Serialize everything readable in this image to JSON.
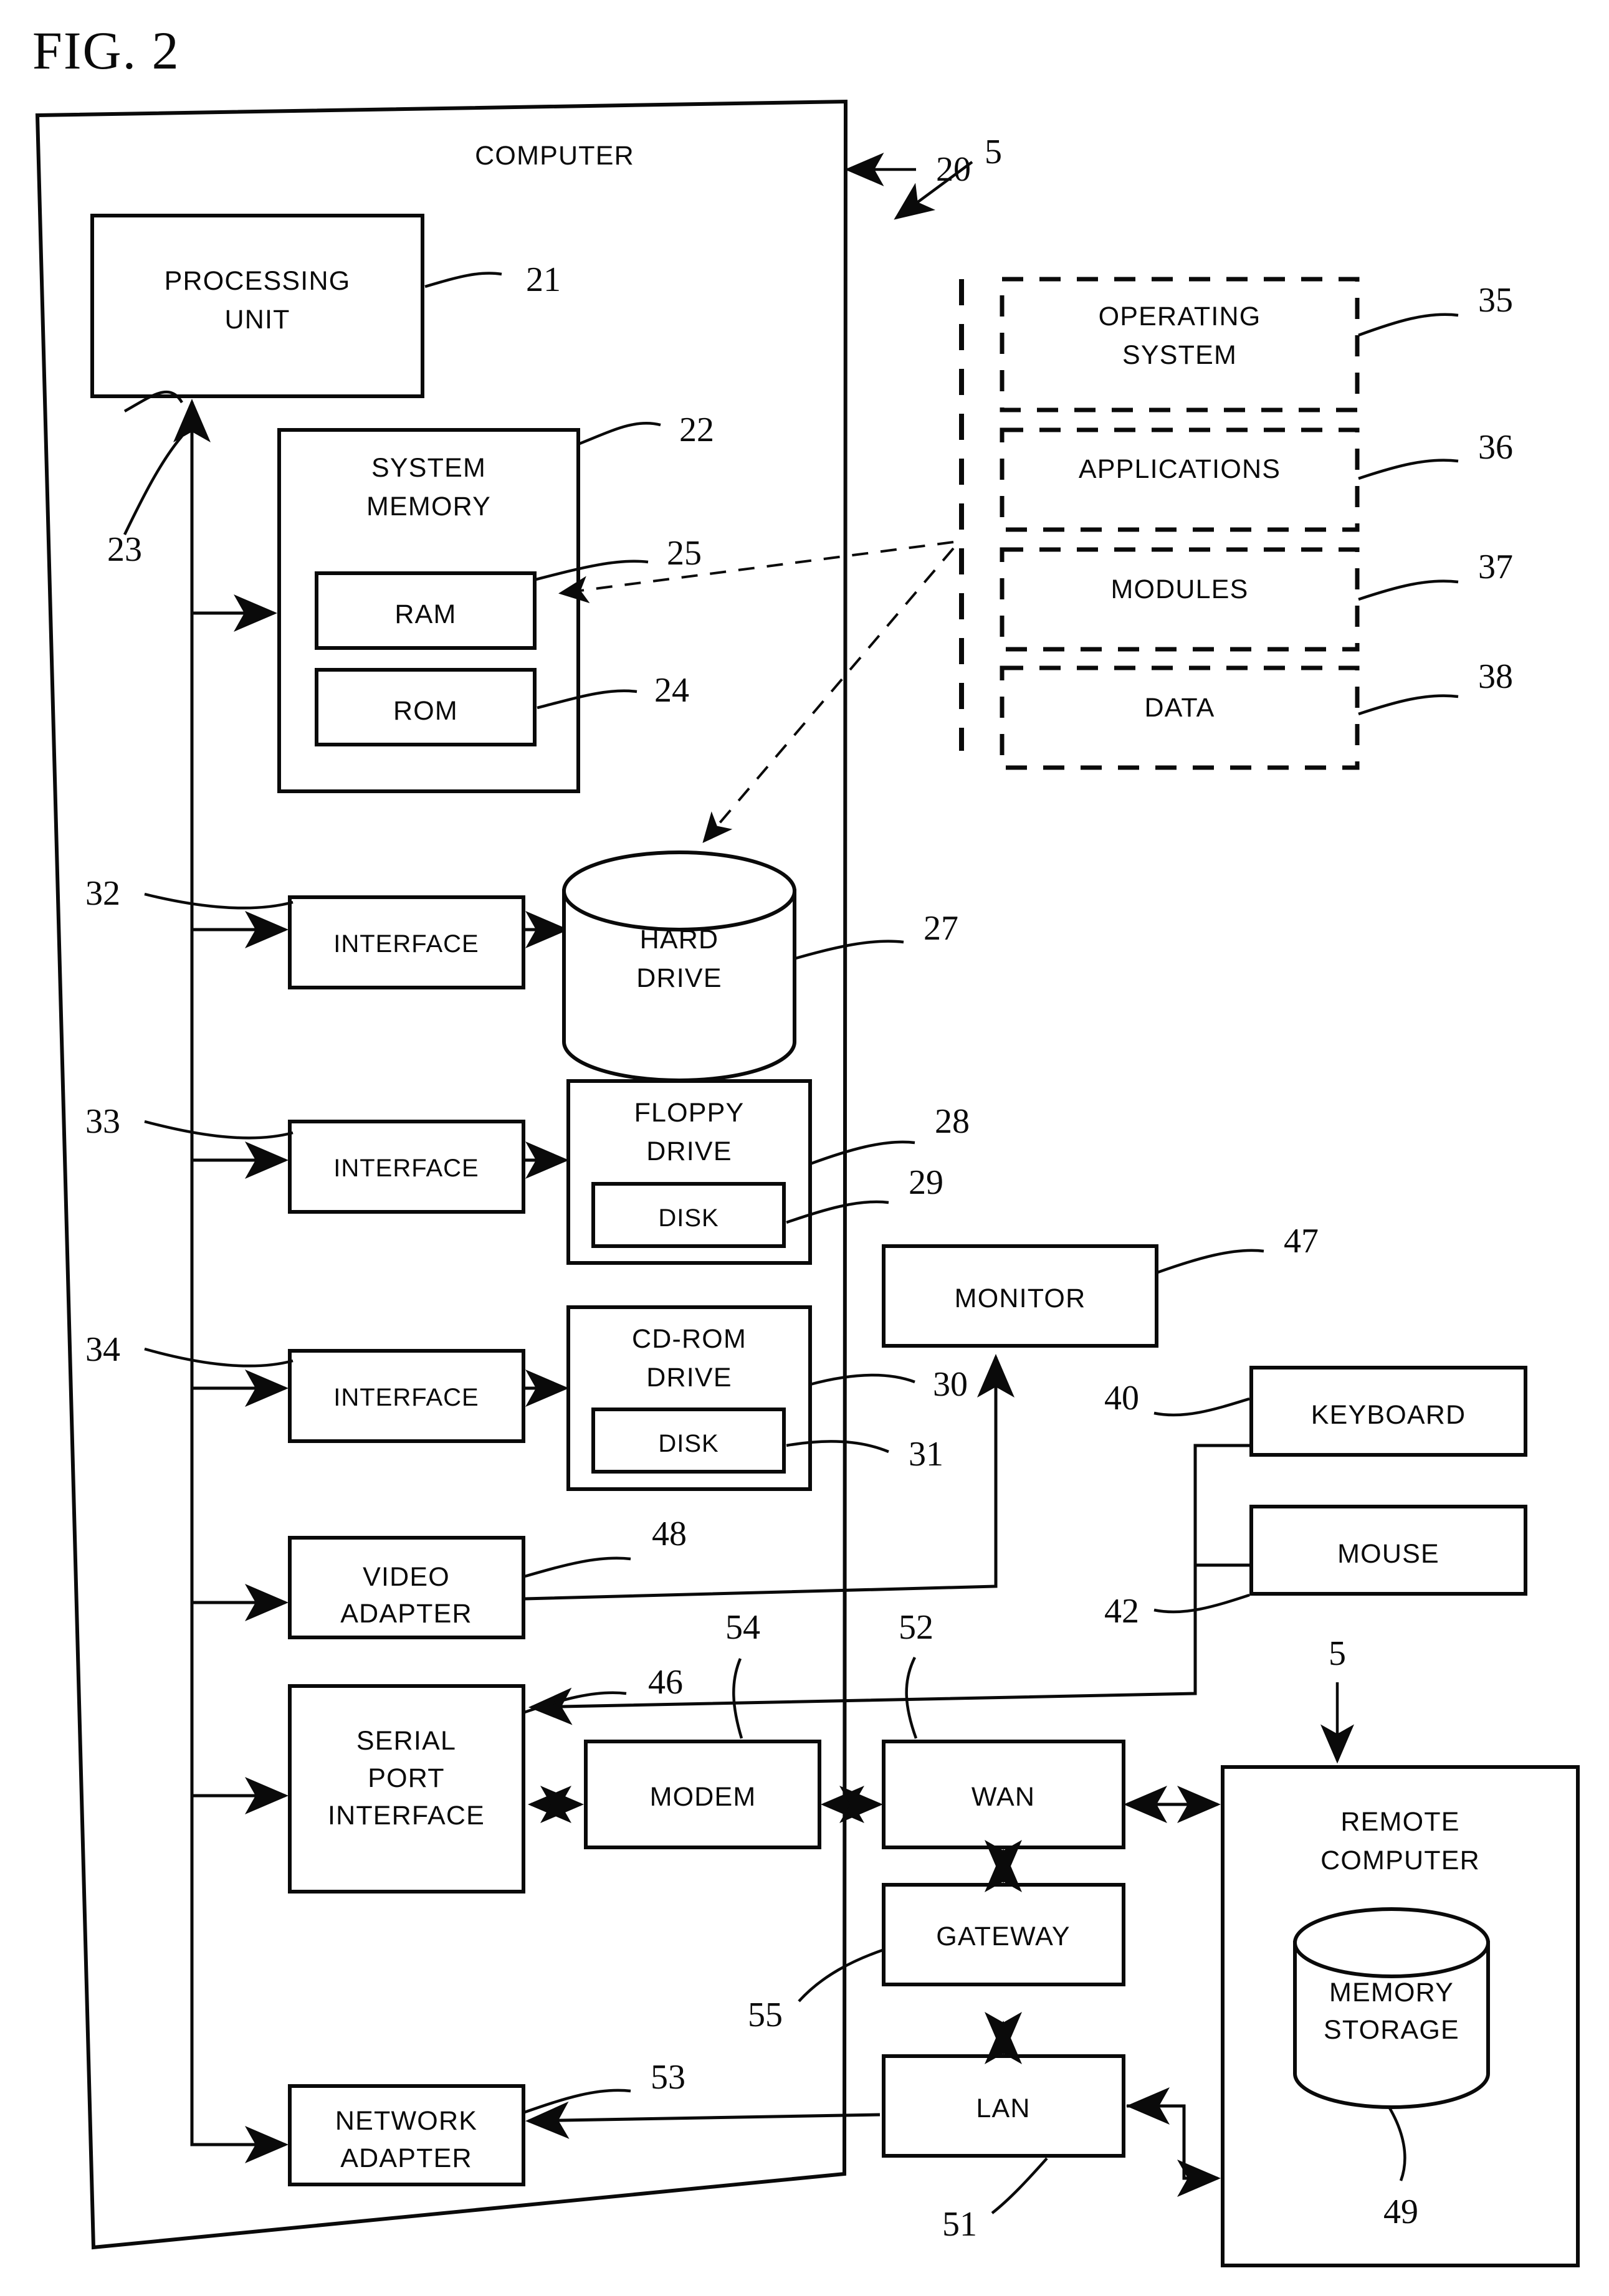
{
  "figure": {
    "title": "FIG. 2",
    "domain_note": "patent block diagram of a general purpose computer system"
  },
  "labels": {
    "computer": "COMPUTER",
    "processing_unit": "PROCESSING\nUNIT",
    "processing_unit_l1": "PROCESSING",
    "processing_unit_l2": "UNIT",
    "system_memory_l1": "SYSTEM",
    "system_memory_l2": "MEMORY",
    "ram": "RAM",
    "rom": "ROM",
    "operating_system_l1": "OPERATING",
    "operating_system_l2": "SYSTEM",
    "applications": "APPLICATIONS",
    "modules": "MODULES",
    "data": "DATA",
    "interface_hdd": "INTERFACE",
    "interface_floppy": "INTERFACE",
    "interface_cdrom": "INTERFACE",
    "hard_drive_l1": "HARD",
    "hard_drive_l2": "DRIVE",
    "floppy_drive_l1": "FLOPPY",
    "floppy_drive_l2": "DRIVE",
    "floppy_disk": "DISK",
    "cdrom_drive_l1": "CD-ROM",
    "cdrom_drive_l2": "DRIVE",
    "cdrom_disk": "DISK",
    "monitor": "MONITOR",
    "keyboard": "KEYBOARD",
    "mouse": "MOUSE",
    "video_adapter_l1": "VIDEO",
    "video_adapter_l2": "ADAPTER",
    "serial_port_interface_l1": "SERIAL",
    "serial_port_interface_l2": "PORT",
    "serial_port_interface_l3": "INTERFACE",
    "modem": "MODEM",
    "wan": "WAN",
    "gateway": "GATEWAY",
    "lan": "LAN",
    "network_adapter_l1": "NETWORK",
    "network_adapter_l2": "ADAPTER",
    "remote_computer_l1": "REMOTE",
    "remote_computer_l2": "COMPUTER",
    "memory_storage_l1": "MEMORY",
    "memory_storage_l2": "STORAGE"
  },
  "reference_numerals": {
    "software_stack": "5",
    "remote_software": "5",
    "computer": "20",
    "processing_unit": "21",
    "system_memory": "22",
    "system_bus": "23",
    "rom": "24",
    "ram": "25",
    "hard_drive": "27",
    "floppy_drive": "28",
    "floppy_disk": "29",
    "cdrom_drive": "30",
    "cdrom_disk": "31",
    "hdd_interface": "32",
    "floppy_interface": "33",
    "cdrom_interface": "34",
    "operating_system": "35",
    "applications": "36",
    "modules": "37",
    "data": "38",
    "keyboard": "40",
    "mouse": "42",
    "serial_port_interface": "46",
    "monitor": "47",
    "video_adapter": "48",
    "memory_storage": "49",
    "lan": "51",
    "wan": "52",
    "network_adapter": "53",
    "modem": "54",
    "gateway": "55"
  },
  "colors": {
    "ink": "#0a0a0a",
    "paper": "#ffffff"
  }
}
